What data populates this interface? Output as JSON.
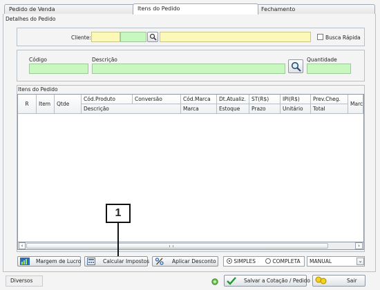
{
  "tabs": [
    "Pedido de Venda",
    "Itens do Pedido",
    "Fechamento"
  ],
  "section_details": "Detalhes do Pedido",
  "cliente_label": "Cliente:",
  "busca_rapida": "Busca Rápida",
  "codigo_label": "Código",
  "descricao_label": "Descrição",
  "quantidade_label": "Quantidade",
  "section_items": "Itens do Pedido",
  "grid": {
    "col_r": "R",
    "col_item": "Item",
    "col_qtde": "Qtde",
    "top": [
      "Cód.Produto",
      "Conversão",
      "Cód.Marca",
      "Dt.Atualiz.",
      "ST(R$)",
      "IPI(R$)",
      "Prev.Cheg."
    ],
    "bottom": [
      "Descrição",
      "",
      "Marca",
      "Estoque",
      "Prazo",
      "Unitário",
      "Total"
    ],
    "col_marca": "Marca"
  },
  "buttons": {
    "margem": "Margem de Lucro",
    "calcular": "Calcular Impostos",
    "aplicar": "Aplicar Desconto",
    "salvar": "Salvar a Cotação / Pedido",
    "sair": "Sair"
  },
  "radio": {
    "simples": "SIMPLES",
    "completa": "COMPLETA"
  },
  "select_value": "MANUAL",
  "callout": "1",
  "diversos": "Diversos"
}
